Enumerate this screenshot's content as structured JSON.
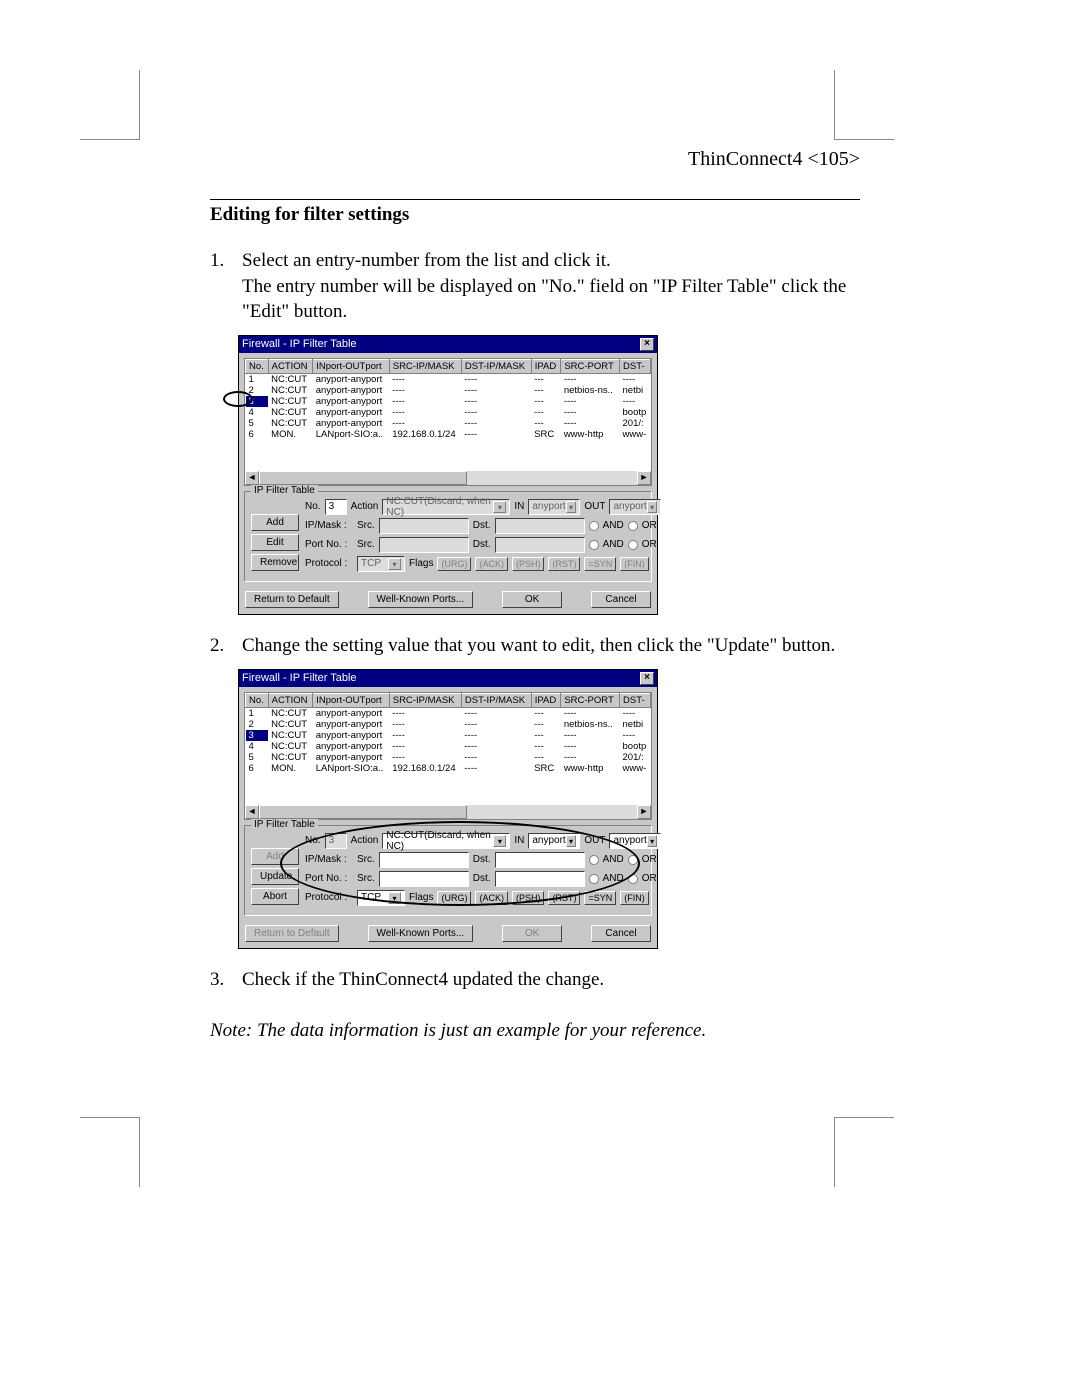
{
  "header": "ThinConnect4 <105>",
  "section_title": "Editing for filter settings",
  "steps": {
    "s1_num": "1.",
    "s1a": "Select an entry-number from the list and click it.",
    "s1b": "The entry number will be displayed on \"No.\" field on \"IP Filter Table\" click the \"Edit\" button.",
    "s2_num": "2.",
    "s2": "Change the setting value that you want to edit, then click the \"Update\" button.",
    "s3_num": "3.",
    "s3": "Check if the ThinConnect4 updated the change."
  },
  "note": "Note: The data information is just an example for your reference.",
  "dialog": {
    "title": "Firewall - IP Filter Table",
    "close": "×",
    "cols": {
      "no": "No.",
      "action": "ACTION",
      "inout": "INport-OUTport",
      "srcip": "SRC-IP/MASK",
      "dstip": "DST-IP/MASK",
      "ipad": "IPAD",
      "srcport": "SRC-PORT",
      "dst": "DST-"
    },
    "rows": {
      "r1": {
        "no": "1",
        "action": "NC:CUT",
        "inout": "anyport-anyport",
        "srcip": "----",
        "dstip": "----",
        "ipad": "---",
        "srcport": "----",
        "dst": "----"
      },
      "r2": {
        "no": "2",
        "action": "NC:CUT",
        "inout": "anyport-anyport",
        "srcip": "----",
        "dstip": "----",
        "ipad": "---",
        "srcport": "netbios-ns..",
        "dst": "netbi"
      },
      "r3": {
        "no": "3",
        "action": "NC:CUT",
        "inout": "anyport-anyport",
        "srcip": "----",
        "dstip": "----",
        "ipad": "---",
        "srcport": "----",
        "dst": "----"
      },
      "r4": {
        "no": "4",
        "action": "NC:CUT",
        "inout": "anyport-anyport",
        "srcip": "----",
        "dstip": "----",
        "ipad": "---",
        "srcport": "----",
        "dst": "bootp"
      },
      "r5": {
        "no": "5",
        "action": "NC:CUT",
        "inout": "anyport-anyport",
        "srcip": "----",
        "dstip": "----",
        "ipad": "---",
        "srcport": "----",
        "dst": "201/:"
      },
      "r6": {
        "no": "6",
        "action": "MON.",
        "inout": "LANport-SIO:a..",
        "srcip": "192.168.0.1/24",
        "dstip": "----",
        "ipad": "SRC",
        "srcport": "www-http",
        "dst": "www-"
      }
    },
    "scroll_left": "◄",
    "scroll_right": "►",
    "group_title": "IP Filter Table",
    "labels": {
      "no": "No.",
      "action": "Action",
      "in": "IN",
      "out": "OUT",
      "ipmask": "IP/Mask :",
      "src": "Src.",
      "dst": "Dst.",
      "and": "AND",
      "or": "OR",
      "portno": "Port No. :",
      "protocol": "Protocol :",
      "flags": "Flags"
    },
    "values": {
      "no1": "3",
      "no2": "3",
      "action_val": "NC:CUT(Discard, when NC)",
      "in_val": "anyport",
      "out_val": "anyport",
      "proto_val": "TCP"
    },
    "flag_buttons": {
      "urg": "(URG)",
      "ack": "(ACK)",
      "psh": "(PSH)",
      "rst": "(RST)",
      "syn": "=SYN",
      "fin": "(FIN)"
    },
    "buttons": {
      "add": "Add",
      "edit": "Edit",
      "remove": "Remove",
      "update": "Update",
      "abort": "Abort",
      "rtd": "Return to Default",
      "wkp": "Well-Known Ports...",
      "ok": "OK",
      "cancel": "Cancel"
    }
  }
}
